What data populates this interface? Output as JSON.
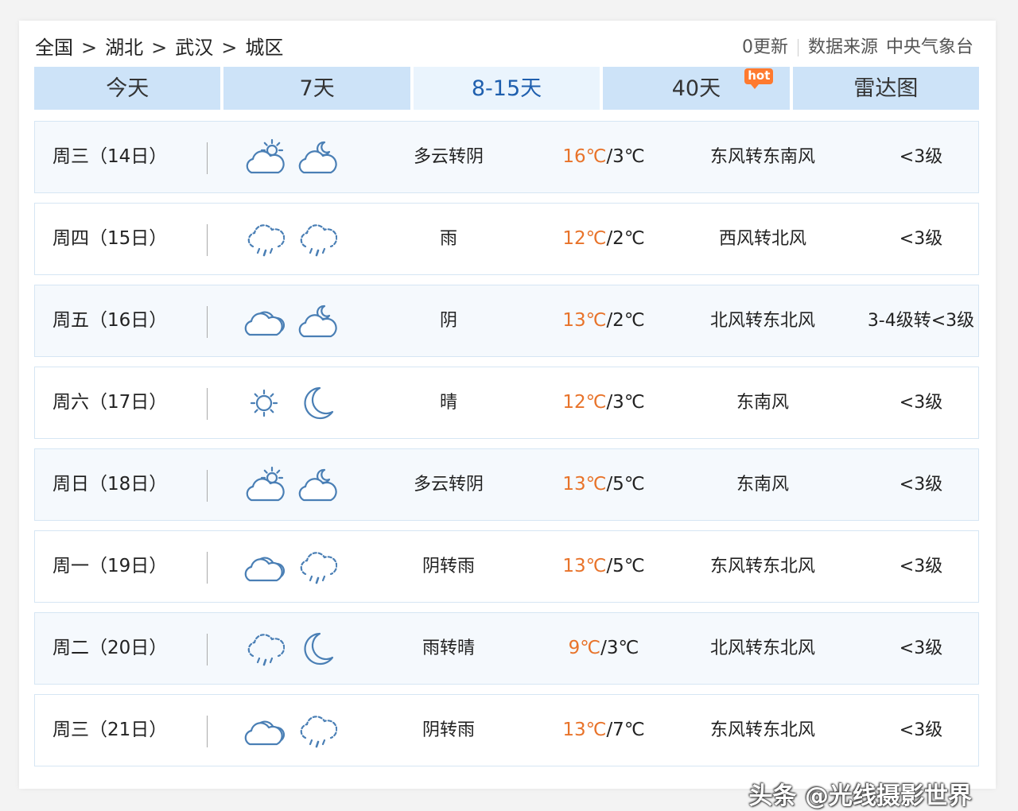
{
  "breadcrumb": [
    "全国",
    "湖北",
    "武汉",
    "城区"
  ],
  "breadcrumb_sep": ">",
  "source": {
    "update": "0更新",
    "label": "数据来源",
    "provider": "中央气象台"
  },
  "tabs": [
    {
      "label": "今天",
      "active": false
    },
    {
      "label": "7天",
      "active": false
    },
    {
      "label": "8-15天",
      "active": true
    },
    {
      "label": "40天",
      "active": false,
      "badge": "hot"
    },
    {
      "label": "雷达图",
      "active": false
    }
  ],
  "forecast": [
    {
      "day": "周三（14日）",
      "icons": [
        "partly-cloudy-sun-icon",
        "partly-cloudy-moon-icon"
      ],
      "cond": "多云转阴",
      "hi": "16℃",
      "lo": "/3℃",
      "wind": "东风转东南风",
      "level": "<3级"
    },
    {
      "day": "周四（15日）",
      "icons": [
        "rain-icon",
        "rain-icon"
      ],
      "cond": "雨",
      "hi": "12℃",
      "lo": "/2℃",
      "wind": "西风转北风",
      "level": "<3级"
    },
    {
      "day": "周五（16日）",
      "icons": [
        "overcast-icon",
        "partly-cloudy-moon-icon"
      ],
      "cond": "阴",
      "hi": "13℃",
      "lo": "/2℃",
      "wind": "北风转东北风",
      "level": "3-4级转<3级"
    },
    {
      "day": "周六（17日）",
      "icons": [
        "sun-icon",
        "moon-icon"
      ],
      "cond": "晴",
      "hi": "12℃",
      "lo": "/3℃",
      "wind": "东南风",
      "level": "<3级"
    },
    {
      "day": "周日（18日）",
      "icons": [
        "partly-cloudy-sun-icon",
        "partly-cloudy-moon-icon"
      ],
      "cond": "多云转阴",
      "hi": "13℃",
      "lo": "/5℃",
      "wind": "东南风",
      "level": "<3级"
    },
    {
      "day": "周一（19日）",
      "icons": [
        "overcast-icon",
        "rain-icon"
      ],
      "cond": "阴转雨",
      "hi": "13℃",
      "lo": "/5℃",
      "wind": "东风转东北风",
      "level": "<3级"
    },
    {
      "day": "周二（20日）",
      "icons": [
        "rain-icon",
        "moon-icon"
      ],
      "cond": "雨转晴",
      "hi": "9℃",
      "lo": "/3℃",
      "wind": "北风转东北风",
      "level": "<3级"
    },
    {
      "day": "周三（21日）",
      "icons": [
        "overcast-icon",
        "rain-icon"
      ],
      "cond": "阴转雨",
      "hi": "13℃",
      "lo": "/7℃",
      "wind": "东风转东北风",
      "level": "<3级"
    }
  ],
  "watermark": "头条 @光线摄影世界",
  "colors": {
    "accent": "#1f5fae",
    "tab_bg": "#cde3f8",
    "high_temp": "#e8732a",
    "icon": "#4a7fb5"
  }
}
